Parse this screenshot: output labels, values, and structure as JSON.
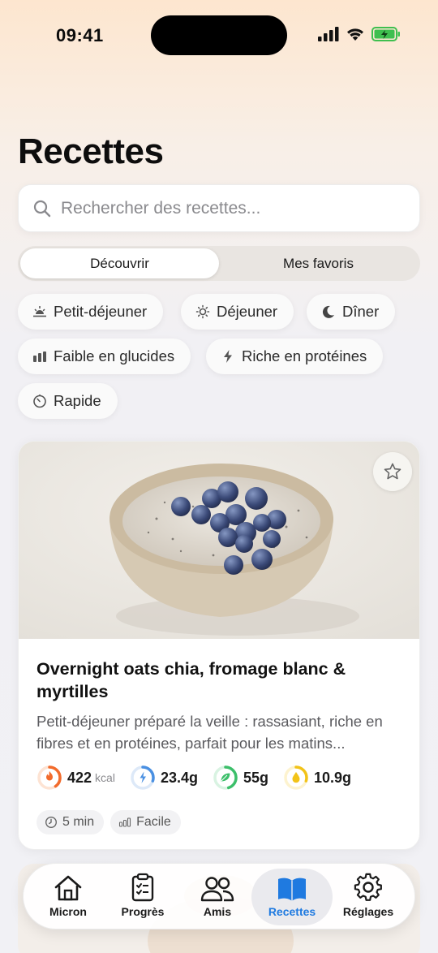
{
  "status_bar": {
    "time": "09:41"
  },
  "page": {
    "title": "Recettes"
  },
  "search": {
    "placeholder": "Rechercher des recettes..."
  },
  "segments": {
    "discover": "Découvrir",
    "favorites": "Mes favoris",
    "active": "discover"
  },
  "filters": [
    {
      "label": "Petit-déjeuner",
      "icon": "sunrise-icon"
    },
    {
      "label": "Déjeuner",
      "icon": "sun-icon"
    },
    {
      "label": "Dîner",
      "icon": "moon-icon"
    },
    {
      "label": "Faible en glucides",
      "icon": "bars-icon"
    },
    {
      "label": "Riche en protéines",
      "icon": "bolt-icon"
    },
    {
      "label": "Rapide",
      "icon": "timer-icon"
    }
  ],
  "recipe": {
    "title": "Overnight oats chia, fromage blanc & myrtilles",
    "description": "Petit-déjeuner préparé la veille : rassasiant, riche en fibres et en protéines, parfait pour les matins...",
    "favorite_icon": "star-icon",
    "macros": {
      "kcal": {
        "value": "422",
        "unit": "kcal",
        "color": "#f26b2c",
        "progress": 0.4
      },
      "protein": {
        "value": "23.4g",
        "color": "#4a90e2",
        "progress": 0.3
      },
      "carbs": {
        "value": "55g",
        "color": "#3cbf6a",
        "progress": 0.45
      },
      "fat": {
        "value": "10.9g",
        "color": "#f2c318",
        "progress": 0.3
      }
    },
    "tags": {
      "time": "5 min",
      "difficulty": "Facile"
    }
  },
  "tabbar": {
    "items": [
      {
        "label": "Micron",
        "icon": "home-icon"
      },
      {
        "label": "Progrès",
        "icon": "clipboard-icon"
      },
      {
        "label": "Amis",
        "icon": "people-icon"
      },
      {
        "label": "Recettes",
        "icon": "book-icon"
      },
      {
        "label": "Réglages",
        "icon": "gear-icon"
      }
    ],
    "active": "Recettes",
    "accent": "#1f7ae0"
  }
}
